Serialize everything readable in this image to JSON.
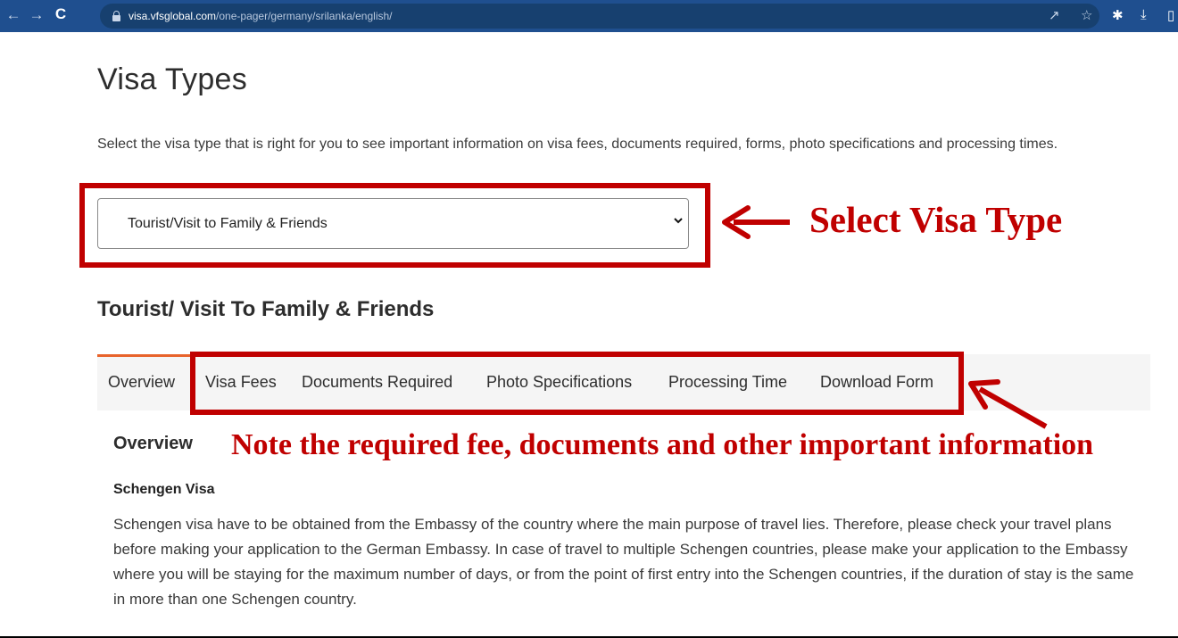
{
  "browser": {
    "url_host": "visa.vfsglobal.com",
    "url_path": "/one-pager/germany/srilanka/english/"
  },
  "page": {
    "title": "Visa Types",
    "intro": "Select the visa type that is right for you to see important information on visa fees, documents required, forms, photo specifications and processing times.",
    "selected_visa_type": "Tourist/Visit to Family & Friends",
    "section_title": "Tourist/ Visit To Family & Friends",
    "tabs": [
      {
        "label": "Overview",
        "active": true
      },
      {
        "label": "Visa Fees"
      },
      {
        "label": "Documents Required"
      },
      {
        "label": "Photo Specifications"
      },
      {
        "label": "Processing Time"
      },
      {
        "label": "Download Form"
      }
    ],
    "overview_heading": "Overview",
    "schengen_heading": "Schengen Visa",
    "schengen_text": "Schengen visa have to be obtained from the Embassy of the country where the main purpose of travel lies. Therefore, please check your travel plans before making your application to the German Embassy. In case of travel to multiple Schengen countries, please make your application to the Embassy where you will be staying for the maximum number of days, or from the point of first entry into the Schengen countries, if the duration of stay is the same in more than one Schengen country."
  },
  "annotations": {
    "select_label": "Select Visa Type",
    "note_label": "Note the required fee, documents and other important information",
    "color": "#c00000"
  },
  "colors": {
    "browser_bar": "#1f4f8f",
    "tab_accent": "#e8632b"
  }
}
